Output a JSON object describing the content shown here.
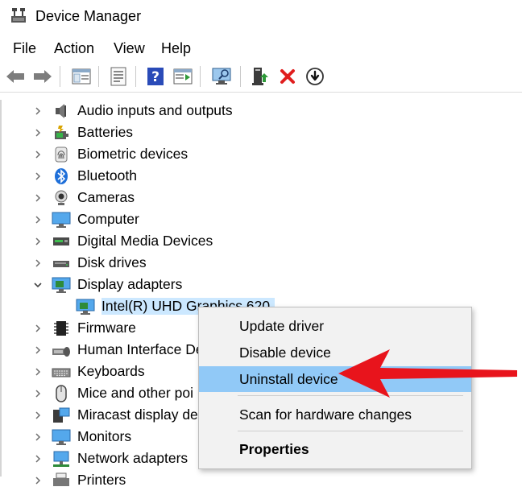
{
  "window": {
    "title": "Device Manager"
  },
  "menu": [
    "File",
    "Action",
    "View",
    "Help"
  ],
  "tree": {
    "categories": [
      {
        "label": "Audio inputs and outputs",
        "icon": "speaker-icon",
        "expanded": false
      },
      {
        "label": "Batteries",
        "icon": "battery-icon",
        "expanded": false
      },
      {
        "label": "Biometric devices",
        "icon": "fingerprint-icon",
        "expanded": false
      },
      {
        "label": "Bluetooth",
        "icon": "bluetooth-icon",
        "expanded": false
      },
      {
        "label": "Cameras",
        "icon": "camera-icon",
        "expanded": false
      },
      {
        "label": "Computer",
        "icon": "monitor-icon",
        "expanded": false
      },
      {
        "label": "Digital Media Devices",
        "icon": "media-device-icon",
        "expanded": false
      },
      {
        "label": "Disk drives",
        "icon": "disk-icon",
        "expanded": false
      },
      {
        "label": "Display adapters",
        "icon": "display-adapter-icon",
        "expanded": true
      },
      {
        "label": "Firmware",
        "icon": "chip-icon",
        "expanded": false
      },
      {
        "label": "Human Interface De",
        "icon": "hid-icon",
        "expanded": false
      },
      {
        "label": "Keyboards",
        "icon": "keyboard-icon",
        "expanded": false
      },
      {
        "label": "Mice and other poi",
        "icon": "mouse-icon",
        "expanded": false
      },
      {
        "label": "Miracast display de",
        "icon": "miracast-icon",
        "expanded": false
      },
      {
        "label": "Monitors",
        "icon": "monitor-icon",
        "expanded": false
      },
      {
        "label": "Network adapters",
        "icon": "network-icon",
        "expanded": false
      },
      {
        "label": "Printers",
        "icon": "printer-icon",
        "expanded": false
      }
    ],
    "child": {
      "label": "Intel(R) UHD Graphics 620",
      "icon": "display-adapter-icon"
    }
  },
  "context_menu": {
    "items": [
      "Update driver",
      "Disable device",
      "Uninstall device"
    ],
    "scan": "Scan for hardware changes",
    "properties": "Properties",
    "highlighted": "Uninstall device"
  },
  "colors": {
    "accent": "#cce8ff",
    "highlight": "#91c9f7",
    "arrow": "#e8141c"
  }
}
